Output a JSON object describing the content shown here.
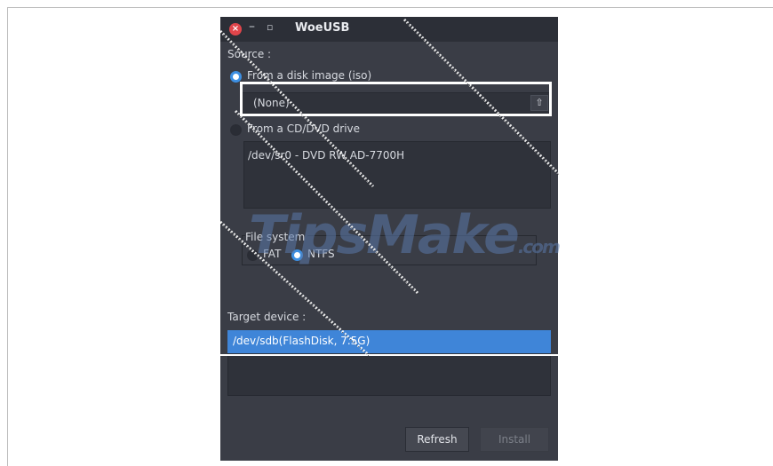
{
  "window": {
    "title": "WoeUSB",
    "close_glyph": "×",
    "minimize_glyph": "–",
    "maximize_glyph": "▫"
  },
  "source": {
    "label": "Source :",
    "iso_option": "From a disk image (iso)",
    "iso_value": "(None)",
    "browse_icon": "upload-icon",
    "browse_glyph": "⇧",
    "cd_option": "From a CD/DVD drive",
    "drives": [
      "/dev/sr0 - DVD RW AD-7700H"
    ]
  },
  "filesystem": {
    "label": "File system",
    "options": [
      "FAT",
      "NTFS"
    ],
    "selected": "NTFS"
  },
  "target": {
    "label": "Target device :",
    "devices": [
      "/dev/sdb(FlashDisk, 7.5G)"
    ]
  },
  "buttons": {
    "refresh": "Refresh",
    "install": "Install"
  },
  "watermark": {
    "text": "TipsMake",
    "suffix": ".com"
  },
  "colors": {
    "accent": "#3f85d8",
    "window_bg": "#3a3d46",
    "titlebar_bg": "#2c2f37",
    "close": "#e0454b"
  }
}
